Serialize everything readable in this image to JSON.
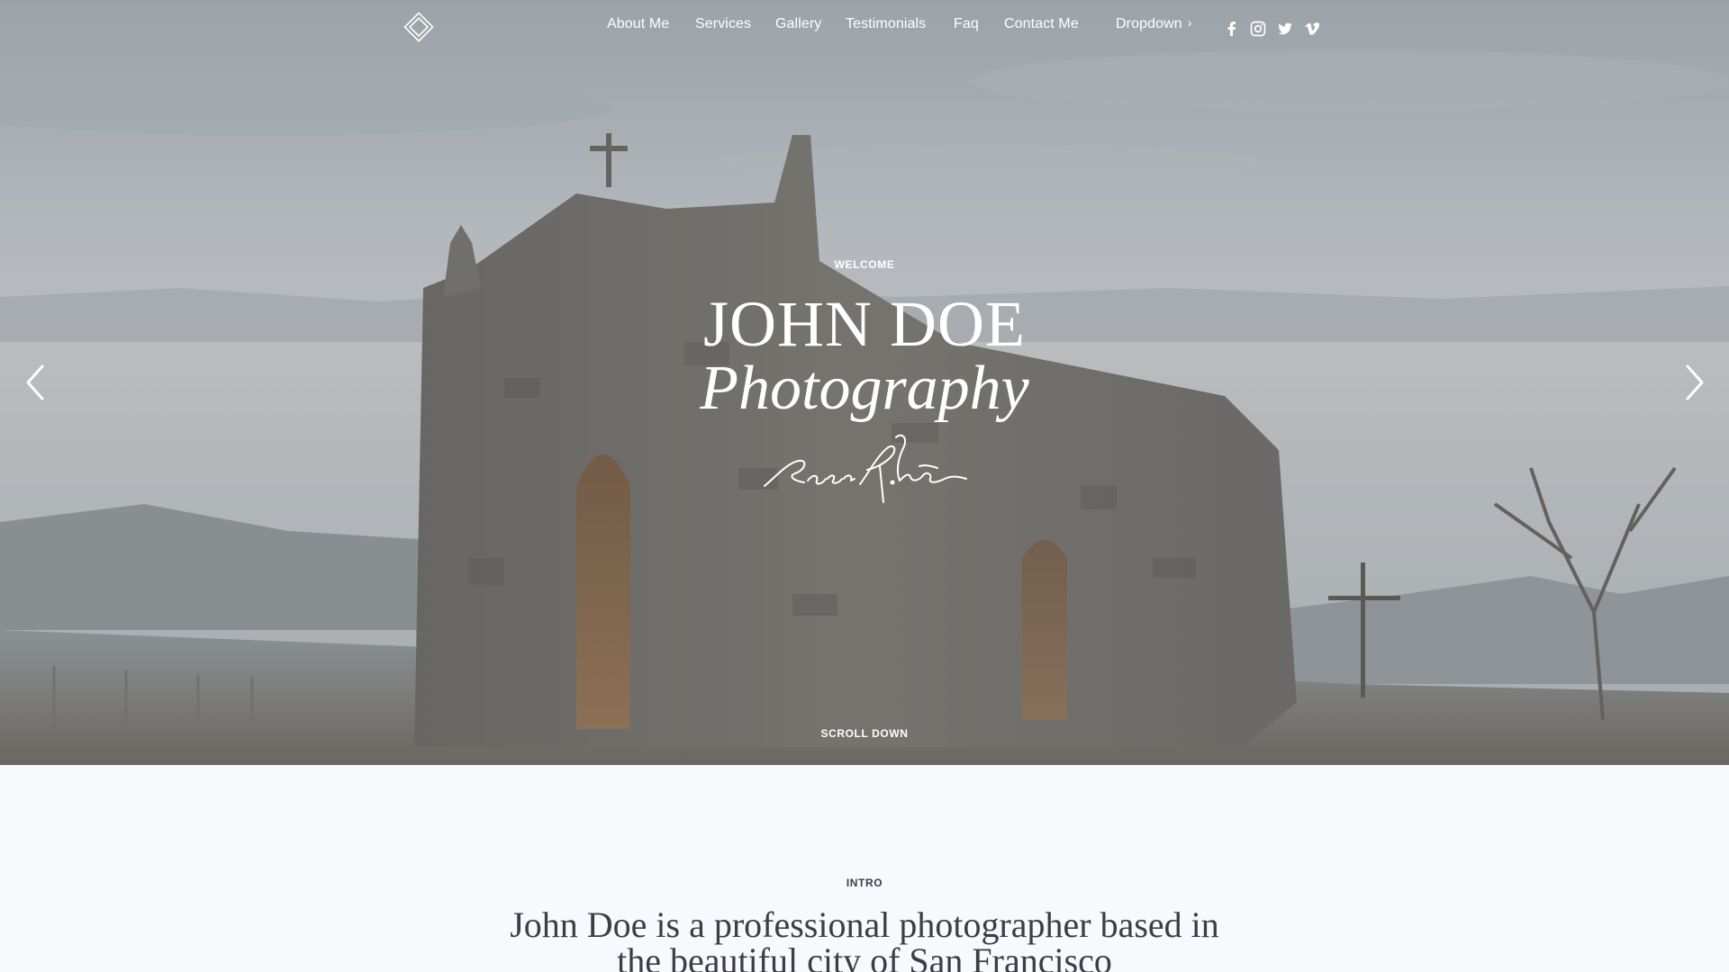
{
  "nav": {
    "logo_icon": "diamond-logo-icon",
    "items": [
      {
        "label": "About Me"
      },
      {
        "label": "Services"
      },
      {
        "label": "Gallery"
      },
      {
        "label": "Testimonials"
      },
      {
        "label": "Faq"
      },
      {
        "label": "Contact Me"
      }
    ],
    "dropdown": {
      "label": "Dropdown",
      "icon": "chevron-right-icon"
    },
    "social": [
      {
        "icon": "facebook-icon"
      },
      {
        "icon": "instagram-icon"
      },
      {
        "icon": "twitter-icon"
      },
      {
        "icon": "vimeo-icon"
      }
    ]
  },
  "hero": {
    "eyebrow": "WELCOME",
    "title": "JOHN DOE",
    "subtitle": "Photography",
    "signature_icon": "handwritten-signature",
    "prev_icon": "chevron-left-icon",
    "next_icon": "chevron-right-icon",
    "scroll_label": "SCROLL DOWN"
  },
  "intro": {
    "label": "INTRO",
    "text": "John Doe is a professional photographer based in the beautiful city of San Francisco"
  },
  "colors": {
    "text_light": "#ffffff",
    "page_background": "#f8f9fd",
    "body_text": "#3b3e46"
  }
}
